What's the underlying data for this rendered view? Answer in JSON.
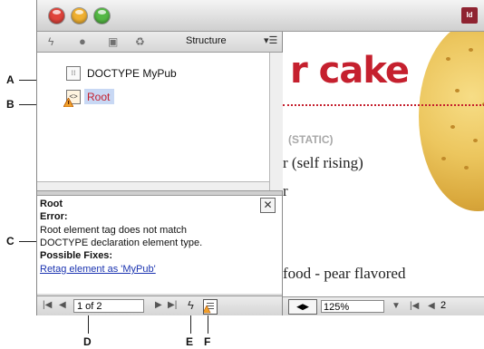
{
  "callouts": {
    "a": "A",
    "b": "B",
    "c": "C",
    "d": "D",
    "e": "E",
    "f": "F"
  },
  "window": {
    "app_icon": "Id"
  },
  "panel": {
    "title": "Structure",
    "menu_glyph": "▾☰",
    "toolbar_icons": [
      "lightning-icon",
      "dot-icon",
      "tag-icon",
      "trash-icon"
    ]
  },
  "tree": {
    "doctype_label": "DOCTYPE MyPub",
    "root_label": "Root"
  },
  "info": {
    "element": "Root",
    "error_heading": "Error:",
    "error_line1": "Root element tag does not match",
    "error_line2": "DOCTYPE declaration element type.",
    "fixes_heading": "Possible Fixes:",
    "fix_link": "Retag element as 'MyPub'"
  },
  "panel_nav": {
    "page": "1 of 2"
  },
  "document": {
    "heading": "r cake",
    "static_label": "(STATIC)",
    "line1": "r (self rising)",
    "line2": "r",
    "line3": "food - pear flavored"
  },
  "doc_nav": {
    "zoom": "125%",
    "page": "2"
  },
  "colors": {
    "heading_red": "#c5202e",
    "selection": "#c8d8f4",
    "link": "#1a33b0"
  }
}
